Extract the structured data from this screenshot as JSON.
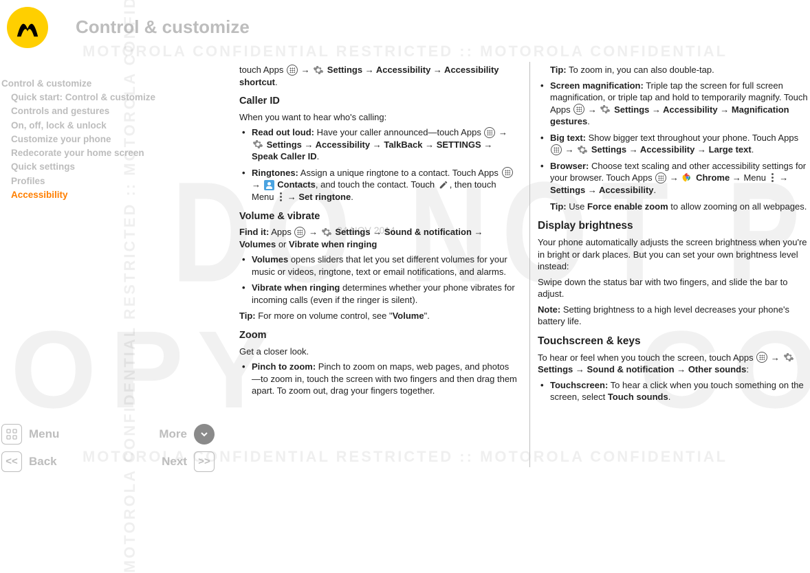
{
  "page_title": "Control & customize",
  "watermarks": {
    "big1": "DO NOT PROCEED",
    "big2": "COPY",
    "curve": "MOTOROLA CONFIDENTIAL RESTRICTED :: MOTOROLA CONFIDENTIAL",
    "date": "24 NOV 2014"
  },
  "nav": [
    {
      "label": "Control & customize",
      "child": false,
      "active": false
    },
    {
      "label": "Quick start: Control & customize",
      "child": true,
      "active": false
    },
    {
      "label": "Controls and gestures",
      "child": true,
      "active": false
    },
    {
      "label": "On, off, lock & unlock",
      "child": true,
      "active": false
    },
    {
      "label": "Customize your phone",
      "child": true,
      "active": false
    },
    {
      "label": "Redecorate your home screen",
      "child": true,
      "active": false
    },
    {
      "label": "Quick settings",
      "child": true,
      "active": false
    },
    {
      "label": "Profiles",
      "child": true,
      "active": false
    },
    {
      "label": "Accessibility",
      "child": true,
      "active": true
    }
  ],
  "bottom": {
    "menu": "Menu",
    "more": "More",
    "back": "Back",
    "next": "Next",
    "back_glyph": "<<",
    "next_glyph": ">>"
  },
  "col1": {
    "p1a": "touch Apps ",
    "p1b": " → ",
    "p1c": " Settings → Accessibility → Accessibility shortcut",
    "p1d": ".",
    "h_callerid": "Caller ID",
    "p_callerid": "When you want to hear who's calling:",
    "li_read_t": "Read out loud:",
    "li_read_b": " Have your caller announced—touch Apps ",
    "li_read_c": " → ",
    "li_read_d": " Settings → Accessibility → TalkBack → SETTINGS → Speak Caller ID",
    "li_read_e": ".",
    "li_ring_t": "Ringtones:",
    "li_ring_b": " Assign a unique ringtone to a contact. Touch Apps ",
    "li_ring_c": " → ",
    "li_ring_d": " Contacts",
    "li_ring_e": ", and touch the contact. Touch ",
    "li_ring_f": ", then touch Menu ",
    "li_ring_g": " → ",
    "li_ring_h": "Set ringtone",
    "li_ring_i": ".",
    "h_volume": "Volume & vibrate",
    "p_find_a": "Find it:",
    "p_find_b": " Apps ",
    "p_find_c": " → ",
    "p_find_d": " Settings → Sound & notification → Volumes",
    "p_find_e": " or ",
    "p_find_f": "Vibrate when ringing",
    "li_vol_t": "Volumes",
    "li_vol_b": " opens sliders that let you set different volumes for your music or videos, ringtone, text or email notifications, and alarms.",
    "li_vib_t": "Vibrate when ringing",
    "li_vib_b": " determines whether your phone vibrates for incoming calls (even if the ringer is silent).",
    "p_tip_t": "Tip:",
    "p_tip_b": " For more on volume control, see \"",
    "p_tip_c": "Volume",
    "p_tip_d": "\".",
    "h_zoom": "Zoom",
    "p_zoom": "Get a closer look.",
    "li_pinch_t": "Pinch to zoom:",
    "li_pinch_b": " Pinch to zoom on maps, web pages, and photos—to zoom in, touch the screen with two fingers and then drag them apart. To zoom out, drag your fingers together."
  },
  "col2": {
    "p_tip1_t": "Tip:",
    "p_tip1_b": " To zoom in, you can also double-tap.",
    "li_mag_t": "Screen magnification:",
    "li_mag_b": " Triple tap the screen for full screen magnification, or triple tap and hold to temporarily magnify. Touch Apps ",
    "li_mag_c": " → ",
    "li_mag_d": " Settings → Accessibility → Magnification gestures",
    "li_mag_e": ".",
    "li_big_t": "Big text:",
    "li_big_b": " Show bigger text throughout your phone. Touch Apps ",
    "li_big_c": " → ",
    "li_big_d": " Settings → Accessibility → Large text",
    "li_big_e": ".",
    "li_brw_t": "Browser:",
    "li_brw_b": " Choose text scaling and other accessibility settings for your browser. Touch Apps ",
    "li_brw_c": " → ",
    "li_brw_d": " Chrome → ",
    "li_brw_e": "Menu ",
    "li_brw_f": " → ",
    "li_brw_g": "Settings → Accessibility",
    "li_brw_h": ".",
    "p_tip2_t": "Tip:",
    "p_tip2_b": " Use ",
    "p_tip2_c": "Force enable zoom",
    "p_tip2_d": " to allow zooming on all webpages.",
    "h_disp": "Display brightness",
    "p_disp1": "Your phone automatically adjusts the screen brightness when you're in bright or dark places. But you can set your own brightness level instead:",
    "p_disp2": "Swipe down the status bar with two fingers, and slide the bar to adjust.",
    "p_note_t": "Note:",
    "p_note_b": " Setting brightness to a high level decreases your phone's battery life.",
    "h_touch": "Touchscreen & keys",
    "p_touch_a": "To hear or feel when you touch the screen, touch Apps ",
    "p_touch_b": " → ",
    "p_touch_c": " Settings → Sound & notification → Other sounds",
    "p_touch_d": ":",
    "li_ts_t": "Touchscreen:",
    "li_ts_b": " To hear a click when you touch something on the screen, select ",
    "li_ts_c": "Touch sounds",
    "li_ts_d": "."
  }
}
